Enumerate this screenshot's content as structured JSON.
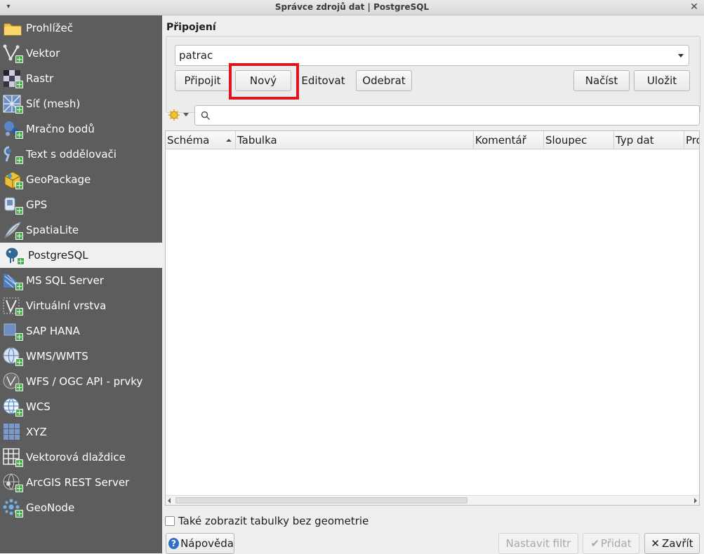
{
  "window": {
    "title": "Správce zdrojů dat | PostgreSQL",
    "menu_glyph": "▾",
    "close_glyph": "✕"
  },
  "sidebar": {
    "items": [
      {
        "label": "Prohlížeč",
        "icon": "folder-icon"
      },
      {
        "label": "Vektor",
        "icon": "vector-icon"
      },
      {
        "label": "Rastr",
        "icon": "raster-icon"
      },
      {
        "label": "Síť (mesh)",
        "icon": "mesh-icon"
      },
      {
        "label": "Mračno bodů",
        "icon": "point-cloud-icon"
      },
      {
        "label": "Text s oddělovači",
        "icon": "delimited-text-icon"
      },
      {
        "label": "GeoPackage",
        "icon": "geopackage-icon"
      },
      {
        "label": "GPS",
        "icon": "gps-icon"
      },
      {
        "label": "SpatiaLite",
        "icon": "spatialite-icon"
      },
      {
        "label": "PostgreSQL",
        "icon": "postgresql-icon",
        "active": true
      },
      {
        "label": "MS SQL Server",
        "icon": "mssql-icon"
      },
      {
        "label": "Virtuální vrstva",
        "icon": "virtual-layer-icon"
      },
      {
        "label": "SAP HANA",
        "icon": "sap-hana-icon"
      },
      {
        "label": "WMS/WMTS",
        "icon": "wms-icon"
      },
      {
        "label": "WFS / OGC API - prvky",
        "icon": "wfs-icon"
      },
      {
        "label": "WCS",
        "icon": "wcs-icon"
      },
      {
        "label": "XYZ",
        "icon": "xyz-icon"
      },
      {
        "label": "Vektorová dlaždice",
        "icon": "vector-tile-icon"
      },
      {
        "label": "ArcGIS REST Server",
        "icon": "arcgis-icon"
      },
      {
        "label": "GeoNode",
        "icon": "geonode-icon"
      }
    ]
  },
  "connections": {
    "label": "Připojení",
    "selected": "patrac",
    "buttons": {
      "connect": "Připojit",
      "new": "Nový",
      "edit": "Editovat",
      "remove": "Odebrat",
      "load": "Načíst",
      "save": "Uložit"
    }
  },
  "search": {
    "placeholder": ""
  },
  "table": {
    "columns": [
      "Schéma",
      "Tabulka",
      "Komentář",
      "Sloupec",
      "Typ dat",
      "Pro"
    ],
    "rows": []
  },
  "options": {
    "show_no_geometry": "Také zobrazit tabulky bez geometrie"
  },
  "footer": {
    "help": "Nápověda",
    "set_filter": "Nastavit filtr",
    "add": "Přidat",
    "close": "Zavřít"
  },
  "colors": {
    "sidebar_bg": "#5d5d5d",
    "highlight": "#e0151b"
  }
}
